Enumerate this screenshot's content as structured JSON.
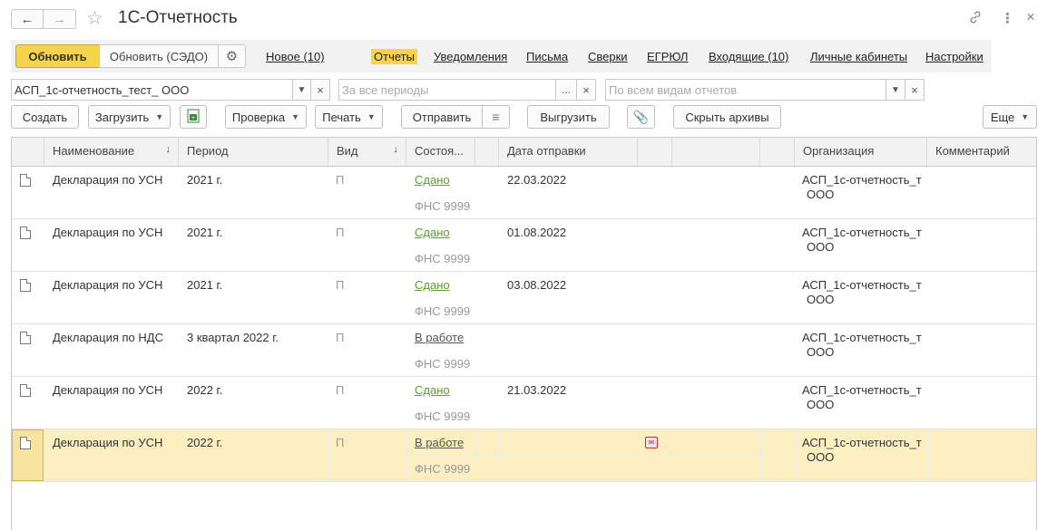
{
  "window": {
    "title": "1С-Отчетность"
  },
  "topmenu": {
    "update_label": "Обновить",
    "update_sedo_label": "Обновить (СЭДО)",
    "links": [
      {
        "label": "Новое (10)"
      },
      {
        "label": "Отчеты"
      },
      {
        "label": "Уведомления"
      },
      {
        "label": "Письма"
      },
      {
        "label": "Сверки"
      },
      {
        "label": "ЕГРЮЛ"
      },
      {
        "label": "Входящие (10)"
      },
      {
        "label": "Личные кабинеты"
      },
      {
        "label": "Настройки"
      }
    ]
  },
  "filters": {
    "organization_value": "АСП_1с-отчетность_тест_ ООО",
    "period_placeholder": "За все периоды",
    "period_select": "...",
    "report_type_placeholder": "По всем видам отчетов",
    "clear_symbol": "×"
  },
  "commands": {
    "create": "Создать",
    "load": "Загрузить",
    "check": "Проверка",
    "print": "Печать",
    "send": "Отправить",
    "export": "Выгрузить",
    "hide_archives": "Скрыть архивы",
    "more": "Еще"
  },
  "table": {
    "columns": {
      "name": "Наименование",
      "period": "Период",
      "kind": "Вид",
      "status": "Состоя...",
      "sent_date": "Дата отправки",
      "organization": "Организация",
      "comment": "Комментарий"
    },
    "rows": [
      {
        "name": "Декларация по УСН",
        "period": "2021 г.",
        "kind": "П",
        "status": "Сдано",
        "authority": "ФНС 9999",
        "sent_date": "22.03.2022",
        "org_line1": "АСП_1с-отчетность_т",
        "org_line2": "ООО"
      },
      {
        "name": "Декларация по УСН",
        "period": "2021 г.",
        "kind": "П",
        "status": "Сдано",
        "authority": "ФНС 9999",
        "sent_date": "01.08.2022",
        "org_line1": "АСП_1с-отчетность_т",
        "org_line2": "ООО"
      },
      {
        "name": "Декларация по УСН",
        "period": "2021 г.",
        "kind": "П",
        "status": "Сдано",
        "authority": "ФНС 9999",
        "sent_date": "03.08.2022",
        "org_line1": "АСП_1с-отчетность_т",
        "org_line2": "ООО"
      },
      {
        "name": "Декларация по НДС",
        "period": "3 квартал 2022 г.",
        "kind": "П",
        "status": "В работе",
        "authority": "ФНС 9999",
        "sent_date": "",
        "org_line1": "АСП_1с-отчетность_т",
        "org_line2": "ООО"
      },
      {
        "name": "Декларация по УСН",
        "period": "2022 г.",
        "kind": "П",
        "status": "Сдано",
        "authority": "ФНС 9999",
        "sent_date": "21.03.2022",
        "org_line1": "АСП_1с-отчетность_т",
        "org_line2": "ООО"
      },
      {
        "name": "Декларация по УСН",
        "period": "2022 г.",
        "kind": "П",
        "status": "В работе",
        "authority": "ФНС 9999",
        "sent_date": "",
        "org_line1": "АСП_1с-отчетность_т",
        "org_line2": "ООО"
      }
    ]
  },
  "colors": {
    "accent_yellow": "#f5d34a",
    "status_done": "#5aa02c",
    "selected_row": "#fbeec0"
  },
  "icons": {
    "back": "arrow-left-icon",
    "forward": "arrow-right-icon",
    "favorite": "star-icon",
    "link": "link-icon",
    "menu": "kebab-icon",
    "close": "close-icon",
    "settings": "gear-icon",
    "document": "document-icon",
    "attach": "paperclip-icon"
  }
}
